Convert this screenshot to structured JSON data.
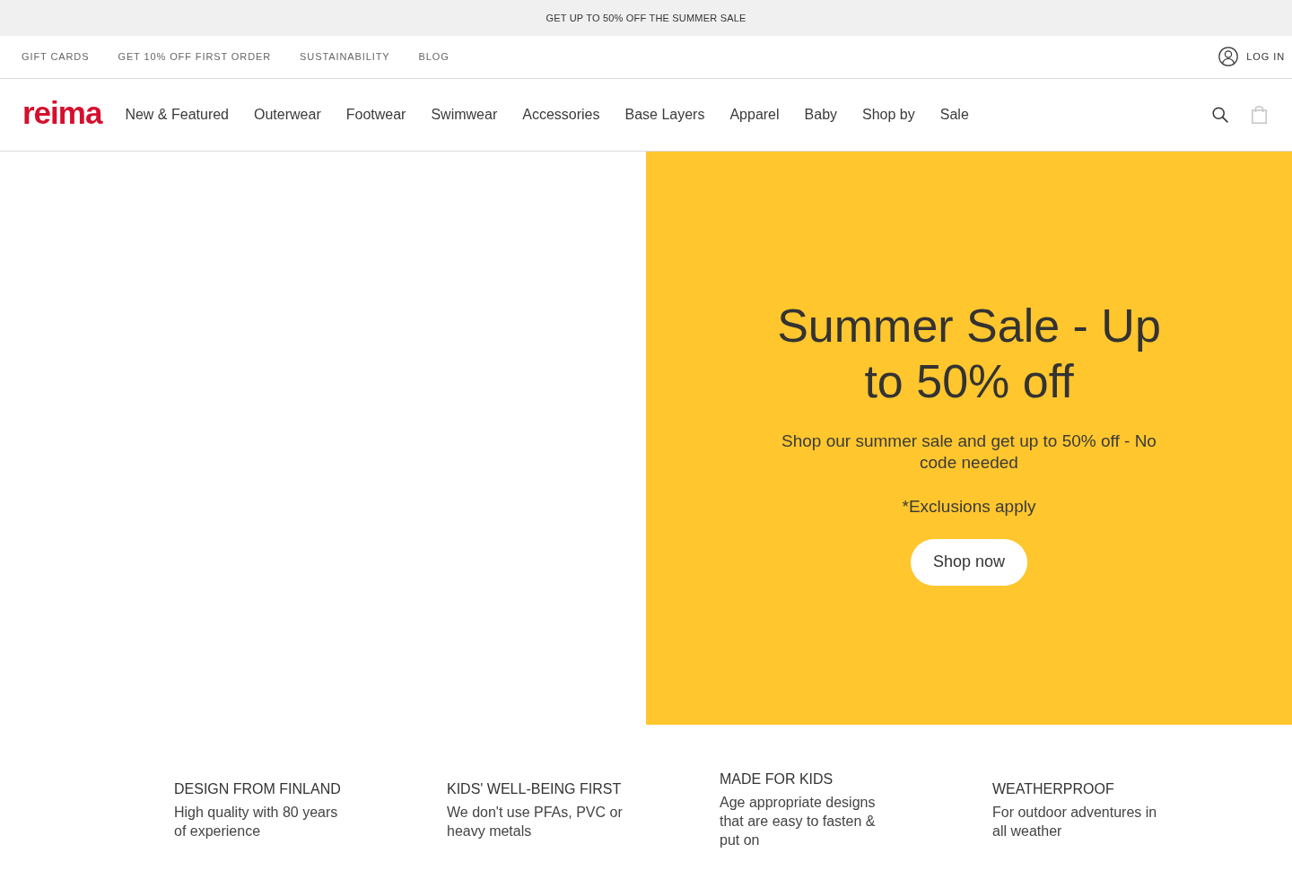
{
  "announcement": "GET UP TO 50% OFF THE SUMMER SALE",
  "utility_nav": {
    "links": [
      "GIFT CARDS",
      "GET 10% OFF FIRST ORDER",
      "SUSTAINABILITY",
      "BLOG"
    ],
    "login": "LOG IN"
  },
  "header": {
    "logo": "reima",
    "nav": [
      "New & Featured",
      "Outerwear",
      "Footwear",
      "Swimwear",
      "Accessories",
      "Base Layers",
      "Apparel",
      "Baby",
      "Shop by",
      "Sale"
    ]
  },
  "hero": {
    "title": "Summer Sale - Up to 50% off",
    "description": "Shop our summer sale and get up to 50% off - No code needed",
    "note": "*Exclusions apply",
    "button": "Shop now"
  },
  "features": [
    {
      "title": "DESIGN FROM FINLAND",
      "text": "High quality with 80 years of experience"
    },
    {
      "title": "KIDS' WELL-BEING FIRST",
      "text": "We don't use PFAs, PVC or heavy metals"
    },
    {
      "title": "MADE FOR KIDS",
      "text": "Age appropriate designs that are easy to fasten & put on"
    },
    {
      "title": "WEATHERPROOF",
      "text": "For outdoor adventures in all weather"
    }
  ]
}
